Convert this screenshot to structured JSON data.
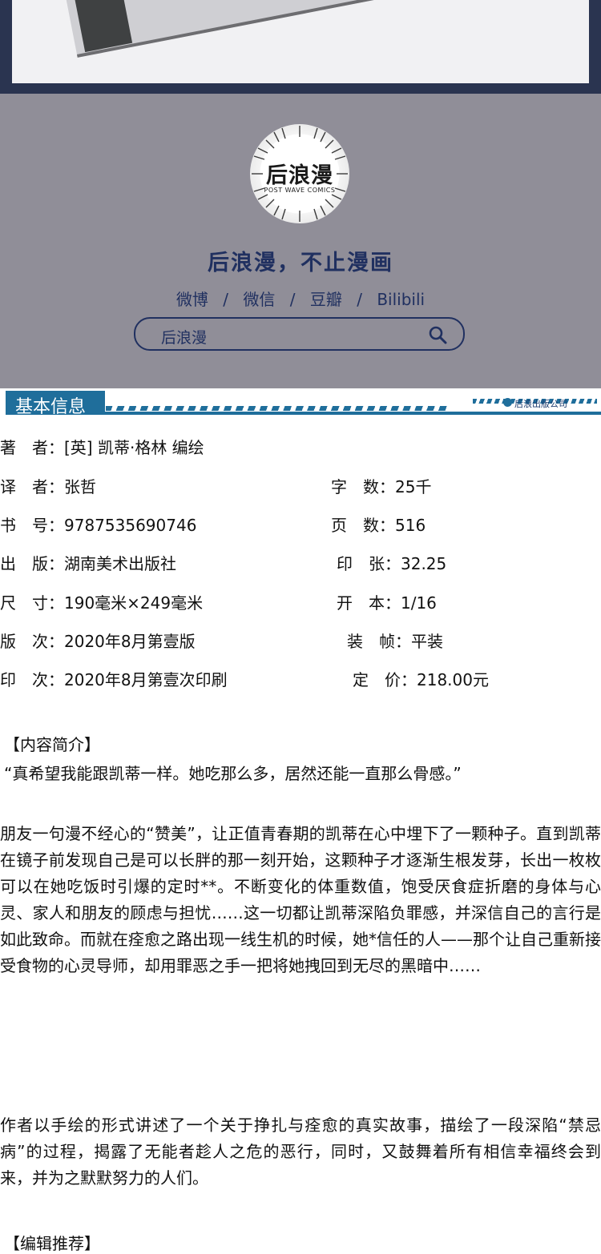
{
  "banner": {
    "logo_main": "后浪漫",
    "logo_sub": "POST WAVE COMICS",
    "slogan": "后浪漫，不止漫画",
    "socials": [
      "微博",
      "微信",
      "豆瓣",
      "Bilibili"
    ],
    "separator": "/",
    "search_text": "后浪漫"
  },
  "section": {
    "title": "基本信息",
    "publisher_mark": "后浪出版公司"
  },
  "info": {
    "author": "著　者：[英] 凯蒂·格林 编绘",
    "translator": "译　者：张哲",
    "word_count": "字　数：25千",
    "isbn": "书　号：9787535690746",
    "pages": "页　数：516",
    "publisher": "出　版：湖南美术出版社",
    "sheets": "印　张：32.25",
    "size": "尺　寸：190毫米×249毫米",
    "format": "开　本：1/16",
    "edition": "版　次：2020年8月第壹版",
    "binding": "装　帧：平装",
    "printing": "印　次：2020年8月第壹次印刷",
    "price": "定　价：218.00元"
  },
  "intro": {
    "heading": "【内容简介】",
    "quote": "“真希望我能跟凯蒂一样。她吃那么多，居然还能一直那么骨感。”",
    "para1": "朋友一句漫不经心的“赞美”，让正值青春期的凯蒂在心中埋下了一颗种子。直到凯蒂在镜子前发现自己是可以长胖的那一刻开始，这颗种子才逐渐生根发芽，长出一枚枚可以在她吃饭时引爆的定时**。不断变化的体重数值，饱受厌食症折磨的身体与心灵、家人和朋友的顾虑与担忧……这一切都让凯蒂深陷负罪感，并深信自己的言行是如此致命。而就在痊愈之路出现一线生机的时候，她*信任的人——那个让自己重新接受食物的心灵导师，却用罪恶之手一把将她拽回到无尽的黑暗中……",
    "para2": "作者以手绘的形式讲述了一个关于挣扎与痊愈的真实故事，描绘了一段深陷“禁忌病”的过程，揭露了无能者趁人之危的恶行，同时，又鼓舞着所有相信幸福终会到来，并为之默默努力的人们。",
    "next_heading": "【编辑推荐】"
  }
}
